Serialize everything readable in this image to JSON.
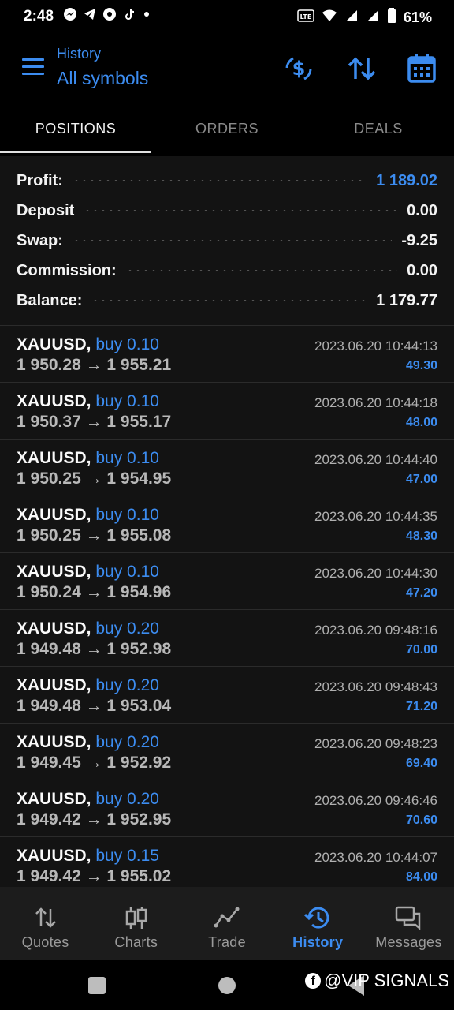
{
  "status_bar": {
    "time": "2:48",
    "battery": "61%",
    "network": "Vo)) LTE1"
  },
  "header": {
    "subtitle": "History",
    "title": "All symbols"
  },
  "tabs": [
    {
      "label": "POSITIONS"
    },
    {
      "label": "ORDERS"
    },
    {
      "label": "DEALS"
    }
  ],
  "summary": {
    "profit": {
      "label": "Profit:",
      "value": "1 189.02"
    },
    "deposit": {
      "label": "Deposit",
      "value": "0.00"
    },
    "swap": {
      "label": "Swap:",
      "value": "-9.25"
    },
    "commission": {
      "label": "Commission:",
      "value": "0.00"
    },
    "balance": {
      "label": "Balance:",
      "value": "1 179.77"
    }
  },
  "deals": [
    {
      "symbol": "XAUUSD,",
      "side": "buy 0.10",
      "prices": "1 950.28 → 1 955.21",
      "time": "2023.06.20 10:44:13",
      "profit": "49.30"
    },
    {
      "symbol": "XAUUSD,",
      "side": "buy 0.10",
      "prices": "1 950.37 → 1 955.17",
      "time": "2023.06.20 10:44:18",
      "profit": "48.00"
    },
    {
      "symbol": "XAUUSD,",
      "side": "buy 0.10",
      "prices": "1 950.25 → 1 954.95",
      "time": "2023.06.20 10:44:40",
      "profit": "47.00"
    },
    {
      "symbol": "XAUUSD,",
      "side": "buy 0.10",
      "prices": "1 950.25 → 1 955.08",
      "time": "2023.06.20 10:44:35",
      "profit": "48.30"
    },
    {
      "symbol": "XAUUSD,",
      "side": "buy 0.10",
      "prices": "1 950.24 → 1 954.96",
      "time": "2023.06.20 10:44:30",
      "profit": "47.20"
    },
    {
      "symbol": "XAUUSD,",
      "side": "buy 0.20",
      "prices": "1 949.48 → 1 952.98",
      "time": "2023.06.20 09:48:16",
      "profit": "70.00"
    },
    {
      "symbol": "XAUUSD,",
      "side": "buy 0.20",
      "prices": "1 949.48 → 1 953.04",
      "time": "2023.06.20 09:48:43",
      "profit": "71.20"
    },
    {
      "symbol": "XAUUSD,",
      "side": "buy 0.20",
      "prices": "1 949.45 → 1 952.92",
      "time": "2023.06.20 09:48:23",
      "profit": "69.40"
    },
    {
      "symbol": "XAUUSD,",
      "side": "buy 0.20",
      "prices": "1 949.42 → 1 952.95",
      "time": "2023.06.20 09:46:46",
      "profit": "70.60"
    },
    {
      "symbol": "XAUUSD,",
      "side": "buy 0.15",
      "prices": "1 949.42 → 1 955.02",
      "time": "2023.06.20 10:44:07",
      "profit": "84.00"
    }
  ],
  "bottom_nav": [
    {
      "label": "Quotes",
      "icon": "arrows-updown-icon"
    },
    {
      "label": "Charts",
      "icon": "candles-icon"
    },
    {
      "label": "Trade",
      "icon": "trend-line-icon"
    },
    {
      "label": "History",
      "icon": "history-clock-icon"
    },
    {
      "label": "Messages",
      "icon": "chat-icon"
    }
  ],
  "watermark": {
    "text": "@VIP SIGNALS"
  },
  "colors": {
    "accent": "#3c8cf0",
    "background": "#131313",
    "bar": "#000000"
  }
}
